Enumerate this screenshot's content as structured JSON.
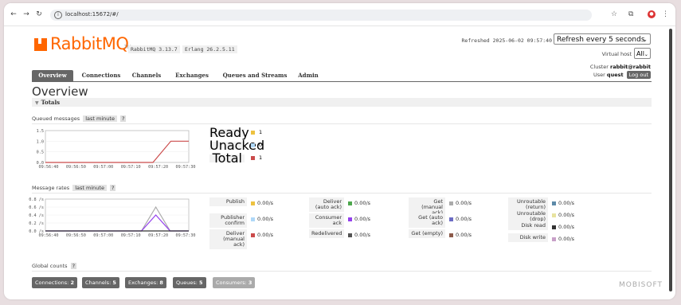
{
  "browser": {
    "url": "localhost:15672/#/"
  },
  "header": {
    "logo_text": "RabbitMQ",
    "logo_tm": "TM",
    "version": "RabbitMQ 3.13.7",
    "erlang": "Erlang 26.2.5.11",
    "refreshed": "Refreshed 2025-06-02 09:57:40",
    "refresh_option": "Refresh every 5 seconds",
    "vhost_label": "Virtual host",
    "vhost_value": "All",
    "cluster_label": "Cluster",
    "cluster_value": "rabbit@rabbit",
    "user_label": "User",
    "user_value": "quest",
    "logout_label": "Log out"
  },
  "tabs": [
    "Overview",
    "Connections",
    "Channels",
    "Exchanges",
    "Queues and Streams",
    "Admin"
  ],
  "page_title": "Overview",
  "totals_label": "Totals",
  "queued": {
    "label": "Queued messages",
    "range": "last minute",
    "help": "?",
    "legend": [
      {
        "label": "Ready",
        "value": "1",
        "color": "#edc240"
      },
      {
        "label": "Unacked",
        "value": "0",
        "color": "#afd8f8"
      },
      {
        "label": "Total",
        "value": "1",
        "color": "#cb4b4b"
      }
    ]
  },
  "rates": {
    "label": "Message rates",
    "range": "last minute",
    "help": "?",
    "columns": [
      [
        {
          "label": "Publish",
          "value": "0.00/s",
          "color": "#edc240"
        },
        {
          "label": "Publisher confirm",
          "value": "0.00/s",
          "color": "#afd8f8"
        },
        {
          "label": "Deliver (manual ack)",
          "value": "0.00/s",
          "color": "#cb4b4b"
        }
      ],
      [
        {
          "label": "Deliver (auto ack)",
          "value": "0.00/s",
          "color": "#4da74d"
        },
        {
          "label": "Consumer ack",
          "value": "0.00/s",
          "color": "#9440ed"
        },
        {
          "label": "Redelivered",
          "value": "0.00/s",
          "color": "#545454"
        }
      ],
      [
        {
          "label": "Get (manual ack)",
          "value": "0.00/s",
          "color": "#aaaaaa"
        },
        {
          "label": "Get (auto ack)",
          "value": "0.00/s",
          "color": "#6c6cc4"
        },
        {
          "label": "Get (empty)",
          "value": "0.00/s",
          "color": "#8c5a4a"
        }
      ],
      [
        {
          "label": "Unroutable (return)",
          "value": "0.00/s",
          "color": "#5d8aa8"
        },
        {
          "label": "Unroutable (drop)",
          "value": "0.00/s",
          "color": "#e8e3a0"
        },
        {
          "label": "Disk read",
          "value": "0.00/s",
          "color": "#333333"
        },
        {
          "label": "Disk write",
          "value": "0.00/s",
          "color": "#c8a0c8"
        }
      ]
    ]
  },
  "global_counts": {
    "label": "Global counts",
    "help": "?",
    "items": [
      {
        "label": "Connections:",
        "value": "2"
      },
      {
        "label": "Channels:",
        "value": "5"
      },
      {
        "label": "Exchanges:",
        "value": "8"
      },
      {
        "label": "Queues:",
        "value": "5"
      },
      {
        "label": "Consumers:",
        "value": "3"
      }
    ]
  },
  "watermark": "MOBISOFT",
  "chart_data": [
    {
      "type": "line",
      "x": [
        "09:56:40",
        "09:56:50",
        "09:57:00",
        "09:57:10",
        "09:57:20",
        "09:57:30"
      ],
      "yticks": [
        "0.0",
        "0.5",
        "1.0",
        "1.5"
      ],
      "ylim": [
        0,
        1.5
      ],
      "series": [
        {
          "name": "Total",
          "color": "#cb4b4b",
          "points": [
            [
              0,
              0
            ],
            [
              0.75,
              0
            ],
            [
              0.875,
              1
            ],
            [
              1,
              1
            ]
          ]
        }
      ]
    },
    {
      "type": "line",
      "x": [
        "09:56:40",
        "09:56:50",
        "09:57:00",
        "09:57:10",
        "09:57:20",
        "09:57:30"
      ],
      "yticks": [
        "0.0 /s",
        "0.2 /s",
        "0.4 /s",
        "0.6 /s",
        "0.8 /s"
      ],
      "ylim": [
        0,
        0.8
      ],
      "series": [
        {
          "name": "Deliver (manual ack)",
          "color": "#aaaaaa",
          "points": [
            [
              0,
              0
            ],
            [
              0.67,
              0
            ],
            [
              0.77,
              0.6
            ],
            [
              0.87,
              0
            ],
            [
              1,
              0
            ]
          ]
        },
        {
          "name": "Consumer ack",
          "color": "#9440ed",
          "points": [
            [
              0,
              0
            ],
            [
              0.67,
              0
            ],
            [
              0.77,
              0.4
            ],
            [
              0.87,
              0
            ],
            [
              1,
              0
            ]
          ]
        },
        {
          "name": "Disk read",
          "color": "#333333",
          "points": [
            [
              0,
              0
            ],
            [
              1,
              0
            ]
          ]
        }
      ]
    }
  ]
}
